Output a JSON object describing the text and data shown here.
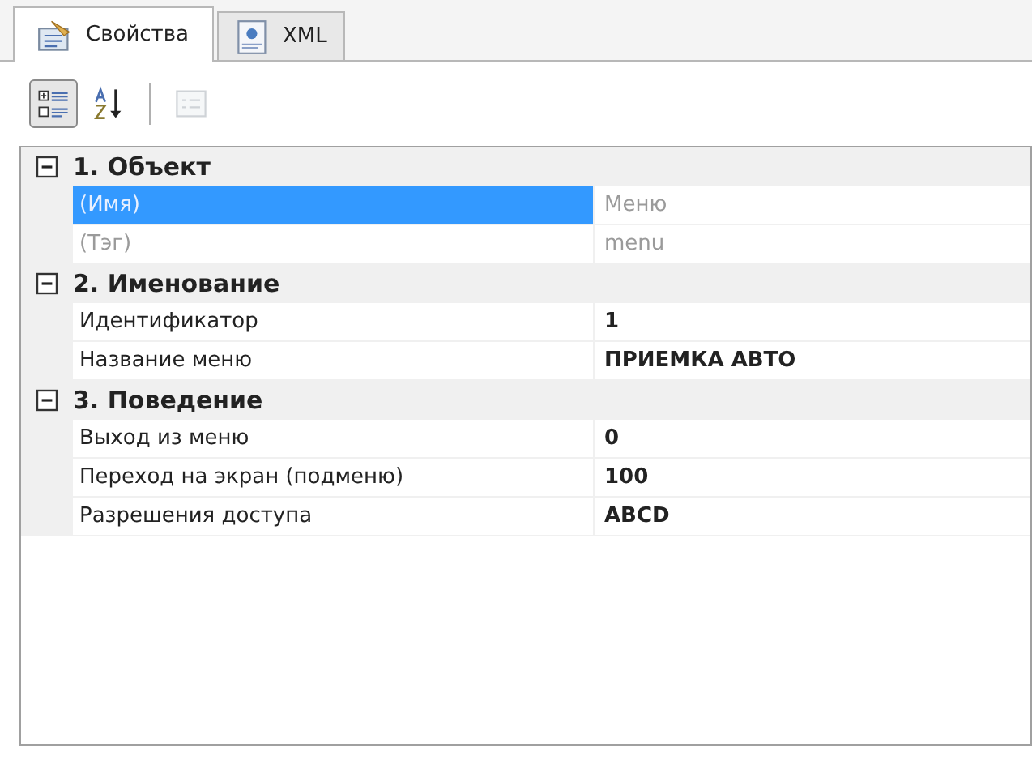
{
  "tabs": [
    {
      "label": "Свойства",
      "selected": true,
      "kind": "properties"
    },
    {
      "label": "XML",
      "selected": false,
      "kind": "xml"
    }
  ],
  "toolbar": [
    {
      "kind": "categorized",
      "selected": true,
      "disabled": false
    },
    {
      "kind": "alphabetical",
      "selected": false,
      "disabled": false
    },
    {
      "kind": "pages",
      "selected": false,
      "disabled": true
    }
  ],
  "categories": [
    {
      "title": "1. Объект",
      "expanded": true,
      "properties": [
        {
          "name": "(Имя)",
          "value": "Меню",
          "selected": true,
          "readonly": true
        },
        {
          "name": "(Тэг)",
          "value": "menu",
          "selected": false,
          "readonly": true
        }
      ]
    },
    {
      "title": "2. Именование",
      "expanded": true,
      "properties": [
        {
          "name": "Идентификатор",
          "value": "1",
          "selected": false,
          "readonly": false
        },
        {
          "name": "Название меню",
          "value": "ПРИЕМКА АВТО",
          "selected": false,
          "readonly": false
        }
      ]
    },
    {
      "title": "3. Поведение",
      "expanded": true,
      "properties": [
        {
          "name": "Выход из меню",
          "value": "0",
          "selected": false,
          "readonly": false
        },
        {
          "name": "Переход на экран (подменю)",
          "value": "100",
          "selected": false,
          "readonly": false
        },
        {
          "name": "Разрешения доступа",
          "value": "ABCD",
          "selected": false,
          "readonly": false
        }
      ]
    }
  ]
}
